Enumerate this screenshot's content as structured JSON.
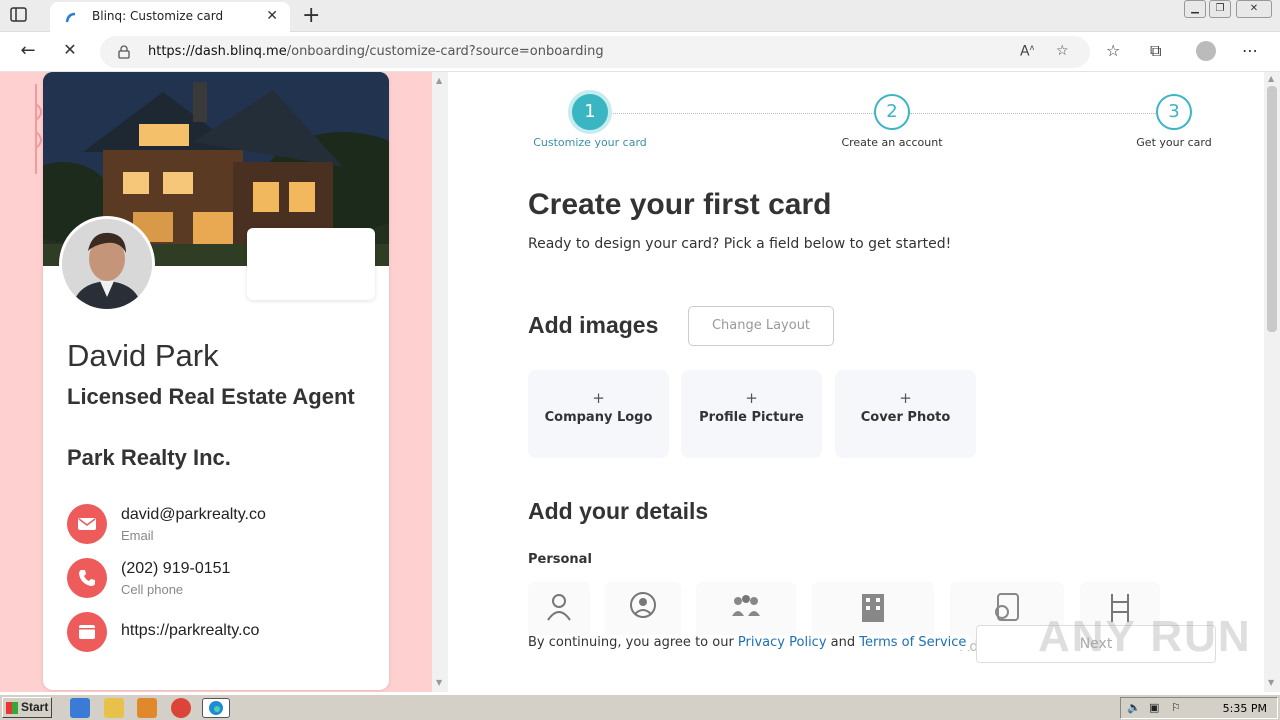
{
  "browser": {
    "tab_title": "Blinq: Customize card",
    "url_host": "https://dash.blinq.me",
    "url_path": "/onboarding/customize-card?source=onboarding"
  },
  "card": {
    "name": "David Park",
    "job_title": "Licensed Real Estate Agent",
    "company": "Park Realty Inc.",
    "contacts": [
      {
        "value": "david@parkrealty.co",
        "label": "Email",
        "icon": "mail-icon"
      },
      {
        "value": "(202) 919-0151",
        "label": "Cell phone",
        "icon": "phone-icon"
      },
      {
        "value": "https://parkrealty.co",
        "label": "",
        "icon": "browser-icon"
      }
    ],
    "accent_color": "#ee5b5b"
  },
  "stepper": {
    "steps": [
      {
        "number": "1",
        "label": "Customize your card",
        "active": true
      },
      {
        "number": "2",
        "label": "Create an account",
        "active": false
      },
      {
        "number": "3",
        "label": "Get your card",
        "active": false
      }
    ],
    "accent_color": "#3ab5c2"
  },
  "main": {
    "title": "Create your first card",
    "subtitle": "Ready to design your card? Pick a field below to get started!",
    "images_heading": "Add images",
    "change_layout": "Change Layout",
    "image_tiles": [
      {
        "plus": "+",
        "label": "Company Logo"
      },
      {
        "plus": "+",
        "label": "Profile Picture"
      },
      {
        "plus": "+",
        "label": "Cover Photo"
      }
    ],
    "details_heading": "Add your details",
    "personal_label": "Personal",
    "footer_prefix": "By continuing, you agree to our ",
    "privacy_link": "Privacy Policy",
    "footer_and": " and ",
    "terms_link": "Terms of Service",
    "next_label": "Next",
    "add_fragment": "Ad"
  },
  "watermark": "ANY RUN",
  "taskbar": {
    "start_label": "Start",
    "clock": "5:35 PM"
  }
}
